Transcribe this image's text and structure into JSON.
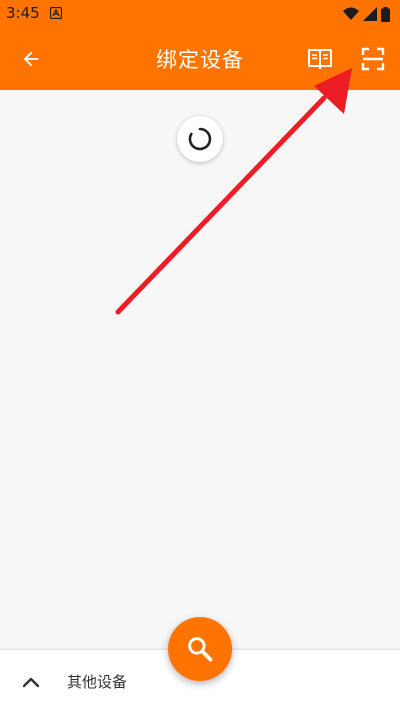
{
  "status_bar": {
    "time": "3:45",
    "notification_icon": "app-notification-icon",
    "icons": [
      "wifi-icon",
      "signal-icon",
      "battery-icon"
    ]
  },
  "app_bar": {
    "title": "绑定设备",
    "back_icon": "arrow-back-icon",
    "guide_icon": "book-icon",
    "scan_icon": "scan-qr-icon"
  },
  "content": {
    "loading_icon": "loading-spinner-icon",
    "annotation": "red-arrow-pointing-to-scan-icon"
  },
  "bottom_sheet": {
    "label": "其他设备",
    "expand_icon": "chevron-up-icon"
  },
  "fab": {
    "icon": "search-icon"
  },
  "colors": {
    "primary": "#ff7400",
    "annotation_arrow": "#ee1c24",
    "background": "#f7f7f7"
  }
}
